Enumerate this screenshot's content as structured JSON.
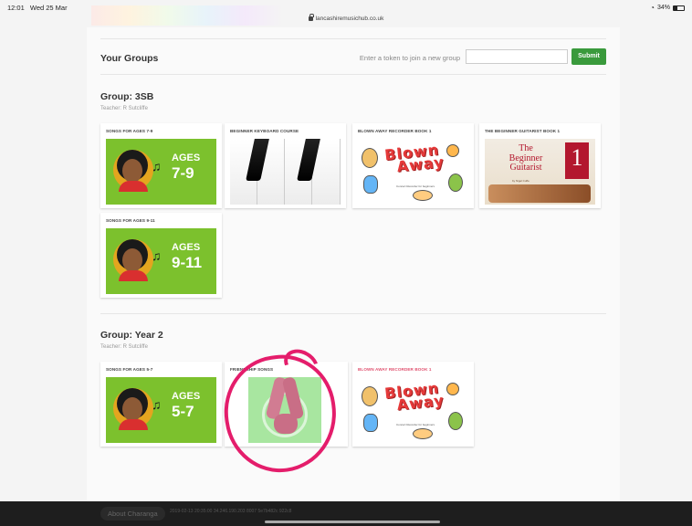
{
  "status_bar": {
    "time": "12:01",
    "date": "Wed 25 Mar",
    "url": "lancashiremusichub.co.uk",
    "battery": "34%",
    "icons": [
      "wifi-icon",
      "lock-icon",
      "battery-icon"
    ]
  },
  "header": {
    "title": "Your Groups",
    "token_label": "Enter a token to join a new group",
    "token_value": "",
    "submit_label": "Submit"
  },
  "colors": {
    "submit_green": "#3a9a3c",
    "ages_green": "#7cc12d",
    "annotation_pink": "#e41d6b",
    "footer_bg": "#1e1e1e"
  },
  "groups": [
    {
      "name": "Group: 3SB",
      "teacher": "Teacher: R Sutcliffe",
      "courses": [
        {
          "title": "SONGS FOR AGES 7-9",
          "ages_word": "AGES",
          "ages_range": "7-9"
        },
        {
          "title": "BEGINNER KEYBOARD COURSE"
        },
        {
          "title": "BLOWN AWAY RECORDER BOOK 1",
          "cover_line1": "Blown",
          "cover_line2": "Away",
          "cover_sub": "Concert Recorder for beginners"
        },
        {
          "title": "THE BEGINNER GUITARIST BOOK 1",
          "cover_line1": "The",
          "cover_line2": "Beginner",
          "cover_line3": "Guitarist",
          "cover_num": "1",
          "cover_author": "by Nigel Cuffe"
        },
        {
          "title": "SONGS FOR AGES 9-11",
          "ages_word": "AGES",
          "ages_range": "9-11"
        }
      ]
    },
    {
      "name": "Group: Year 2",
      "teacher": "Teacher: R Sutcliffe",
      "courses": [
        {
          "title": "SONGS FOR AGES 5-7",
          "ages_word": "AGES",
          "ages_range": "5-7"
        },
        {
          "title": "FRIENDSHIP SONGS"
        },
        {
          "title": "BLOWN AWAY RECORDER BOOK 1",
          "cover_line1": "Blown",
          "cover_line2": "Away",
          "cover_sub": "Concert Recorder for beginners"
        }
      ]
    }
  ],
  "footer": {
    "about_label": "About Charanga",
    "meta": "2019-02-13 20:35:00 34.246.190.203 8007 5e7b482c 922c8"
  }
}
